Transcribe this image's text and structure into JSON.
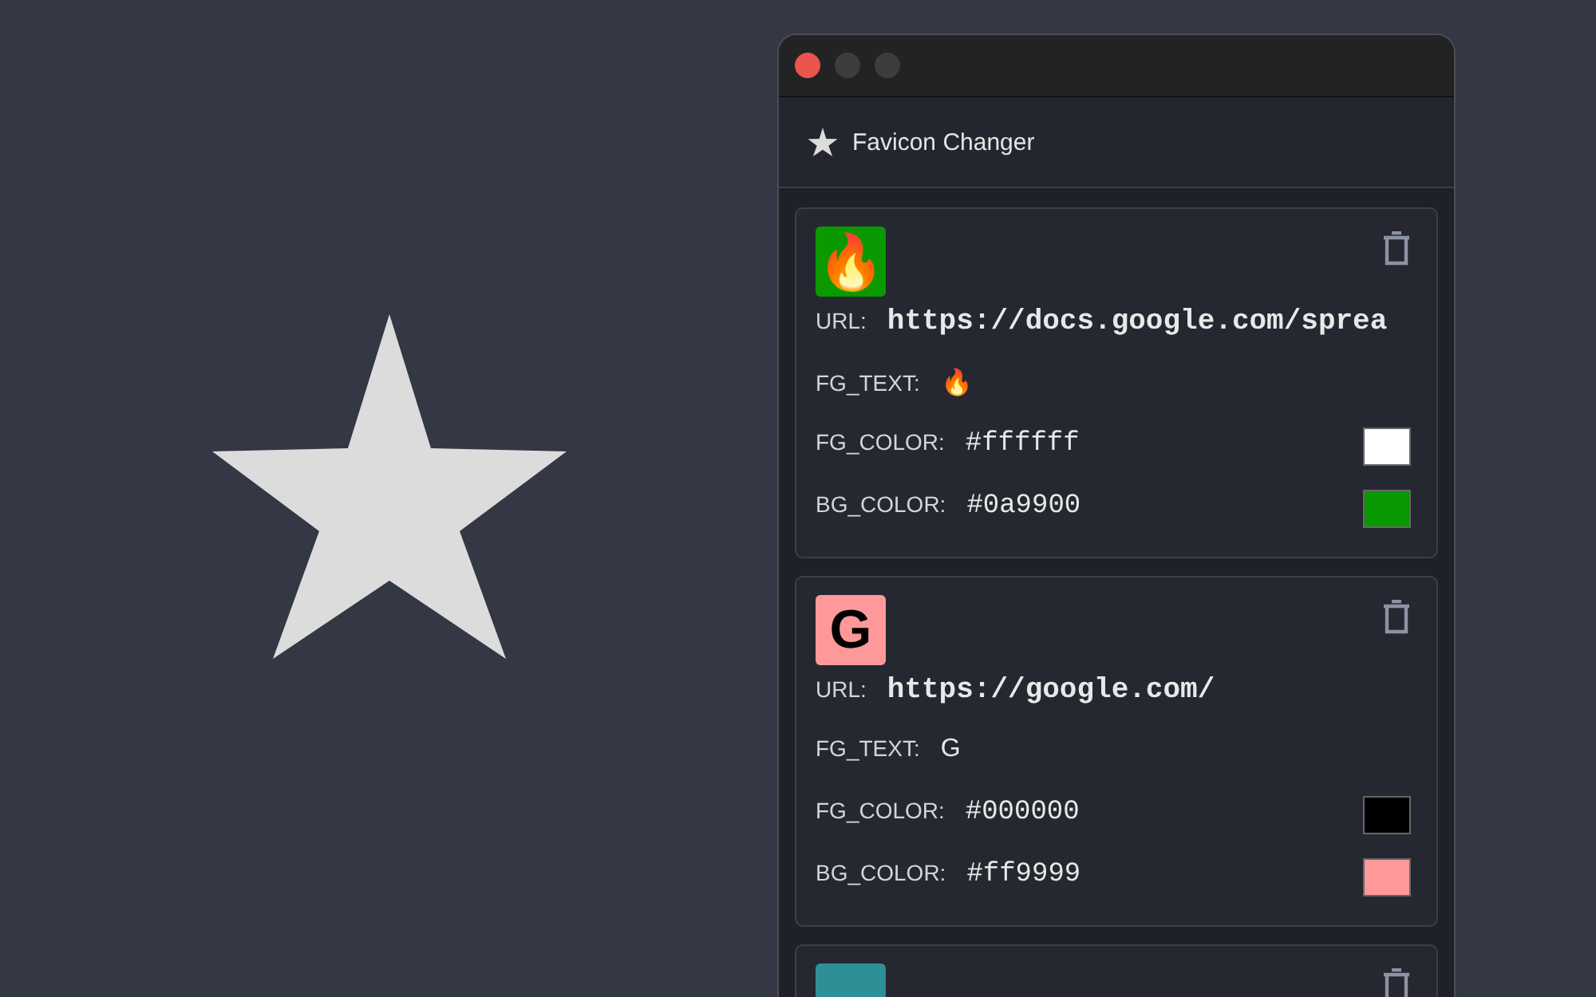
{
  "app_title": "Favicon Changer",
  "entries": [
    {
      "kind": "full",
      "preview_text": "🔥",
      "url": "https://docs.google.com/sprea",
      "fg_text": "🔥",
      "fg_color": "#ffffff",
      "bg_color": "#0a9900",
      "labels": {
        "url": "URL:",
        "fg_text": "FG_TEXT:",
        "fg_color": "FG_COLOR:",
        "bg_color": "BG_COLOR:"
      }
    },
    {
      "kind": "full",
      "preview_text": "G",
      "url": "https://google.com/",
      "fg_text": "G",
      "fg_color": "#000000",
      "bg_color": "#ff9999",
      "labels": {
        "url": "URL:",
        "fg_text": "FG_TEXT:",
        "fg_color": "FG_COLOR:",
        "bg_color": "BG_COLOR:"
      }
    },
    {
      "kind": "partial",
      "color": "#2f8f96"
    }
  ]
}
